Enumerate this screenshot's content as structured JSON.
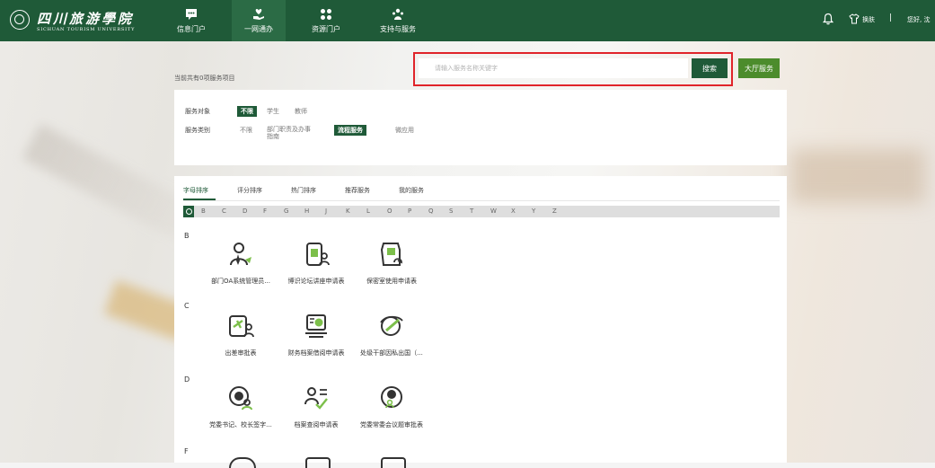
{
  "header": {
    "logo_cn": "四川旅游學院",
    "logo_en": "SICHUAN TOURISM UNIVERSITY",
    "nav": [
      {
        "label": "信息门户",
        "icon": "chat-icon"
      },
      {
        "label": "一网通办",
        "icon": "heart-hand-icon"
      },
      {
        "label": "资源门户",
        "icon": "grid-icon"
      },
      {
        "label": "支持与服务",
        "icon": "people-icon"
      }
    ],
    "skin_label": "换肤",
    "separator": "|",
    "user_greeting": "您好, 沈"
  },
  "search": {
    "count_text": "当前共有0项服务项目",
    "placeholder": "请输入服务名称关键字",
    "value": "",
    "search_label": "搜索",
    "hall_label": "大厅服务"
  },
  "filters": {
    "target": {
      "label": "服务对象",
      "options": [
        "不限",
        "学生",
        "教师"
      ],
      "selected": "不限"
    },
    "category": {
      "label": "服务类别",
      "options": [
        "不限",
        "部门职责及办事指南",
        "流程服务",
        "微应用"
      ],
      "selected": "流程服务"
    }
  },
  "sort_tabs": [
    "字母排序",
    "评分排序",
    "热门排序",
    "推荐服务",
    "我的服务"
  ],
  "letters": [
    "B",
    "C",
    "D",
    "F",
    "G",
    "H",
    "J",
    "K",
    "L",
    "O",
    "P",
    "Q",
    "S",
    "T",
    "W",
    "X",
    "Y",
    "Z"
  ],
  "groups": [
    {
      "letter": "B",
      "items": [
        {
          "name": "部门OA系统管理员...",
          "icon": "admin-user-icon"
        },
        {
          "name": "博识论坛讲座申请表",
          "icon": "lecture-icon"
        },
        {
          "name": "保密室使用申请表",
          "icon": "secret-room-icon"
        }
      ]
    },
    {
      "letter": "C",
      "items": [
        {
          "name": "出差审批表",
          "icon": "business-trip-icon"
        },
        {
          "name": "财务档案借阅申请表",
          "icon": "finance-archive-icon"
        },
        {
          "name": "处级干部因私出国（...",
          "icon": "travel-abroad-icon"
        }
      ]
    },
    {
      "letter": "D",
      "items": [
        {
          "name": "党委书记、校长签字...",
          "icon": "signature-icon"
        },
        {
          "name": "档案查阅申请表",
          "icon": "archive-query-icon"
        },
        {
          "name": "党委常委会议题审批表",
          "icon": "meeting-topic-icon"
        }
      ]
    },
    {
      "letter": "F",
      "items": []
    }
  ],
  "colors": {
    "brand": "#1f5a38",
    "accent": "#4c8c2c",
    "highlight": "#e0242a"
  }
}
